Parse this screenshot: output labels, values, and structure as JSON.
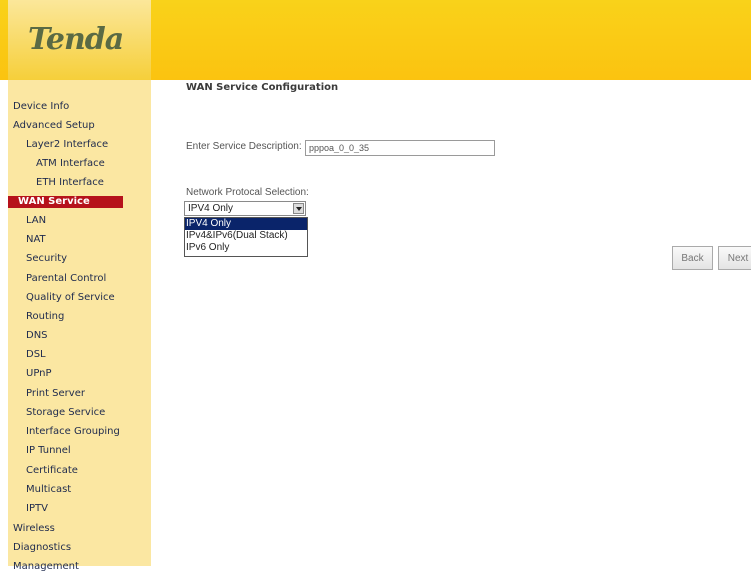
{
  "brand": {
    "logo": "Tenda"
  },
  "sidebar": {
    "items": [
      {
        "label": "Device Info",
        "level": 0,
        "active": false
      },
      {
        "label": "Advanced Setup",
        "level": 0,
        "active": false
      },
      {
        "label": "Layer2 Interface",
        "level": 1,
        "active": false
      },
      {
        "label": "ATM Interface",
        "level": 2,
        "active": false
      },
      {
        "label": "ETH Interface",
        "level": 2,
        "active": false
      },
      {
        "label": "WAN Service",
        "level": 1,
        "active": true
      },
      {
        "label": "LAN",
        "level": 1,
        "active": false
      },
      {
        "label": "NAT",
        "level": 1,
        "active": false
      },
      {
        "label": "Security",
        "level": 1,
        "active": false
      },
      {
        "label": "Parental Control",
        "level": 1,
        "active": false
      },
      {
        "label": "Quality of Service",
        "level": 1,
        "active": false
      },
      {
        "label": "Routing",
        "level": 1,
        "active": false
      },
      {
        "label": "DNS",
        "level": 1,
        "active": false
      },
      {
        "label": "DSL",
        "level": 1,
        "active": false
      },
      {
        "label": "UPnP",
        "level": 1,
        "active": false
      },
      {
        "label": "Print Server",
        "level": 1,
        "active": false
      },
      {
        "label": "Storage Service",
        "level": 1,
        "active": false
      },
      {
        "label": "Interface Grouping",
        "level": 1,
        "active": false
      },
      {
        "label": "IP Tunnel",
        "level": 1,
        "active": false
      },
      {
        "label": "Certificate",
        "level": 1,
        "active": false
      },
      {
        "label": "Multicast",
        "level": 1,
        "active": false
      },
      {
        "label": "IPTV",
        "level": 1,
        "active": false
      },
      {
        "label": "Wireless",
        "level": 0,
        "active": false
      },
      {
        "label": "Diagnostics",
        "level": 0,
        "active": false
      },
      {
        "label": "Management",
        "level": 0,
        "active": false
      }
    ]
  },
  "main": {
    "title": "WAN Service Configuration",
    "description_label": "Enter Service Description:",
    "description_value": "pppoa_0_0_35",
    "protocol_label": "Network Protocal Selection:",
    "protocol_selected": "IPV4 Only",
    "protocol_options": [
      "IPV4 Only",
      "IPv4&IPv6(Dual Stack)",
      "IPv6 Only"
    ],
    "back_label": "Back",
    "next_label": "Next"
  },
  "colors": {
    "banner": "#fbc310",
    "sidebar": "#fbe7a2",
    "active_item": "#b6121b",
    "selected_option": "#0a246a"
  }
}
